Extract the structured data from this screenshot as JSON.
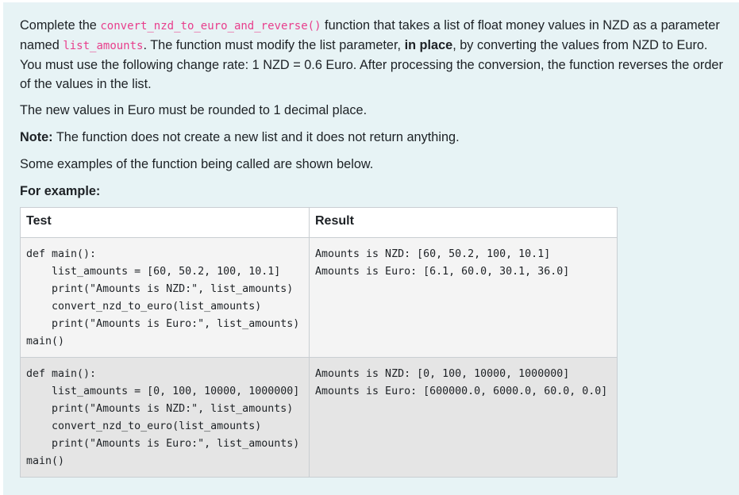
{
  "description": {
    "p1": {
      "t1": "Complete the ",
      "code1": "convert_nzd_to_euro_and_reverse()",
      "t2": " function that takes a list of float money values in NZD as a parameter named ",
      "code2": "list_amounts",
      "t3": ". The function must modify the list parameter, ",
      "bold1": "in place",
      "t4": ", by converting the values from NZD to Euro. You must use the following change rate: 1 NZD = 0.6 Euro. After processing the conversion, the function reverses the order of the values in the list."
    },
    "p2": "The new values in Euro must be rounded to 1 decimal place.",
    "p3": {
      "bold": "Note:",
      "text": " The function does not create a new list and it does not return anything."
    },
    "p4": "Some examples of the function being called are shown below.",
    "p5": "For example:"
  },
  "examples_table": {
    "headers": {
      "test": "Test",
      "result": "Result"
    },
    "rows": [
      {
        "test": "def main():\n    list_amounts = [60, 50.2, 100, 10.1]\n    print(\"Amounts is NZD:\", list_amounts)\n    convert_nzd_to_euro(list_amounts)\n    print(\"Amounts is Euro:\", list_amounts)\nmain()",
        "result": "Amounts is NZD: [60, 50.2, 100, 10.1]\nAmounts is Euro: [6.1, 60.0, 30.1, 36.0]"
      },
      {
        "test": "def main():\n    list_amounts = [0, 100, 10000, 1000000]\n    print(\"Amounts is NZD:\", list_amounts)\n    convert_nzd_to_euro(list_amounts)\n    print(\"Amounts is Euro:\", list_amounts)\nmain()",
        "result": "Amounts is NZD: [0, 100, 10000, 1000000]\nAmounts is Euro: [600000.0, 6000.0, 60.0, 0.0]"
      }
    ]
  },
  "colors": {
    "panel_background": "#e7f3f5",
    "inline_code": "#e83e8c",
    "row_odd_background": "#f4f4f4",
    "row_even_background": "#e5e5e5"
  }
}
